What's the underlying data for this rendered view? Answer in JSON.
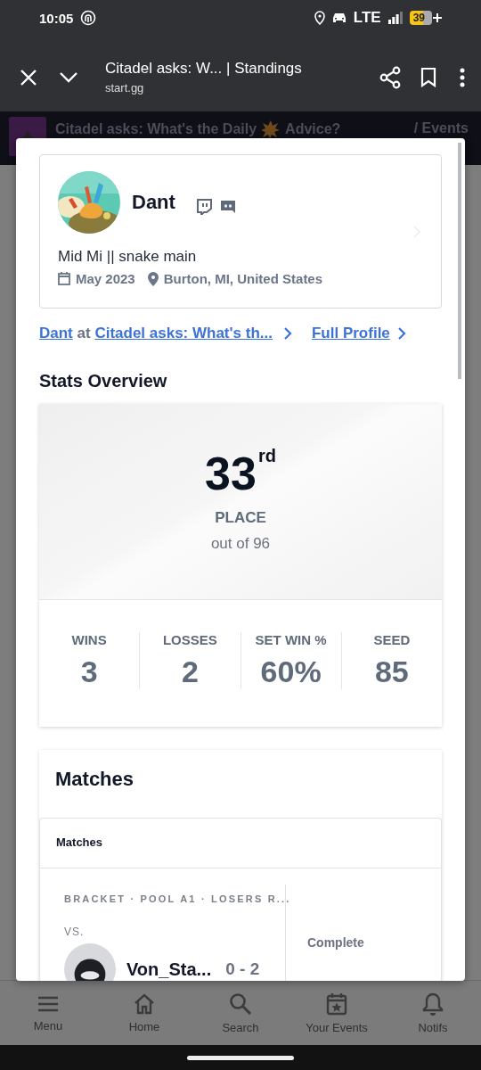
{
  "status_bar": {
    "time": "10:05",
    "network": "LTE",
    "battery": "39"
  },
  "browser": {
    "title": "Citadel asks: W... | Standings",
    "url": "start.gg"
  },
  "page_header": {
    "title_start": "Citadel asks: What's the Daily",
    "title_end": "Advice?",
    "nav": "/ Events"
  },
  "profile": {
    "name": "Dant",
    "bio": "Mid Mi || snake main",
    "joined": "May 2023",
    "location": "Burton, MI, United States"
  },
  "links": {
    "player": "Dant",
    "connector": "at",
    "event": "Citadel asks: What's th...",
    "full_profile": "Full Profile"
  },
  "stats": {
    "title": "Stats Overview",
    "placement": "33$^{rd}$",
    "placement_label": "PLACE",
    "out_of": "out of 96",
    "columns": [
      {
        "label": "WINS",
        "value": "3"
      },
      {
        "label": "LOSSES",
        "value": "2"
      },
      {
        "label": "SET WIN %",
        "value": "60%"
      },
      {
        "label": "SEED",
        "value": "85"
      }
    ]
  },
  "matches": {
    "title": "Matches",
    "table_header": "Matches",
    "rows": [
      {
        "round": "BRACKET · POOL A1 · LOSERS R...",
        "vs": "VS.",
        "opponent": "Von_Sta...",
        "score": "0 - 2",
        "status": "Complete"
      }
    ]
  },
  "bottom_nav": [
    {
      "kind": "menu",
      "label": "Menu"
    },
    {
      "kind": "home",
      "label": "Home"
    },
    {
      "kind": "search",
      "label": "Search"
    },
    {
      "kind": "events",
      "label": "Your Events"
    },
    {
      "kind": "notifs",
      "label": "Notifs"
    }
  ]
}
